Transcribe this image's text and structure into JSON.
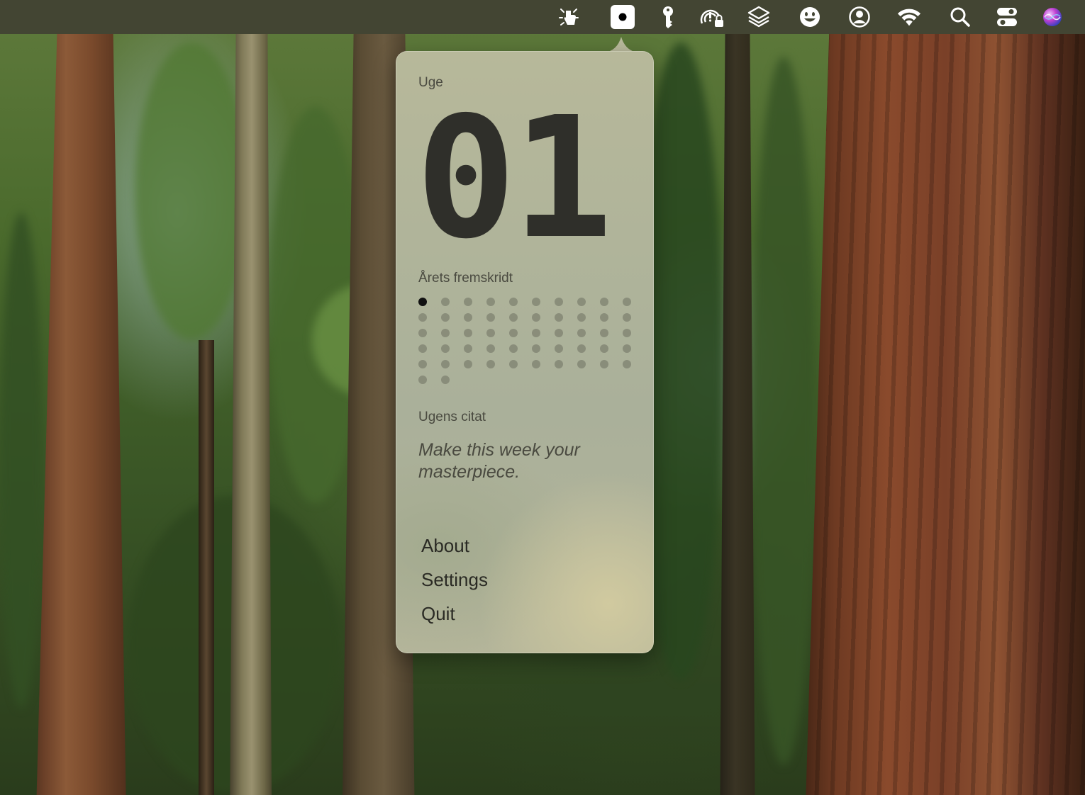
{
  "menubar": {
    "icons": [
      "hand-pointer-icon",
      "week-number-app-icon",
      "key-icon",
      "privacy-lock-icon",
      "layers-icon",
      "smiley-face-icon",
      "user-account-icon",
      "wifi-icon",
      "search-icon",
      "control-center-icon",
      "siri-icon"
    ]
  },
  "popover": {
    "week_label": "Uge",
    "week_number": "01",
    "progress_label": "Årets fremskridt",
    "progress": {
      "completed_weeks": 1,
      "total_weeks": 52
    },
    "quote_label": "Ugens citat",
    "quote": "Make this week your masterpiece.",
    "menu": {
      "about": "About",
      "settings": "Settings",
      "quit": "Quit"
    }
  },
  "colors": {
    "menubar": "#434533",
    "popover": "#b2b59b",
    "progress_done": "#111111",
    "progress_remaining": "#8a8b78"
  }
}
